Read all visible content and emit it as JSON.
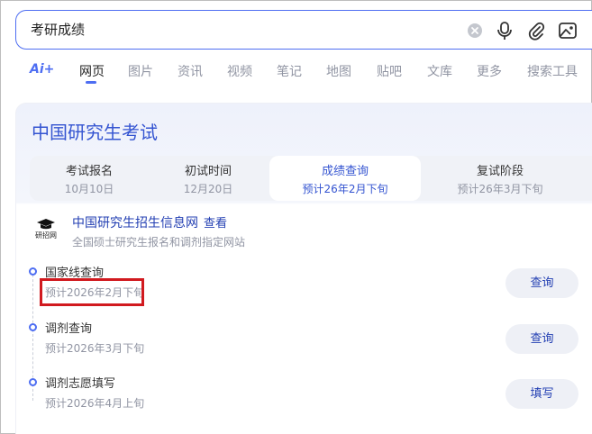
{
  "search": {
    "query": "考研成绩"
  },
  "tabs": {
    "ai": "Ai+",
    "items": [
      "网页",
      "图片",
      "资讯",
      "视频",
      "笔记",
      "地图",
      "贴吧",
      "文库",
      "更多",
      "搜索工具"
    ],
    "active_index": 0
  },
  "card": {
    "title": "中国研究生考试",
    "stages": [
      {
        "label": "考试报名",
        "date": "10月10日"
      },
      {
        "label": "初试时间",
        "date": "12月20日"
      },
      {
        "label": "成绩查询",
        "date": "预计26年2月下旬"
      },
      {
        "label": "复试阶段",
        "date": "预计26年3月下旬"
      }
    ],
    "active_stage": 2,
    "source": {
      "name": "中国研究生招生信息网",
      "view": "查看",
      "desc": "全国硕士研究生报名和调剂指定网站",
      "logo_text": "研招网"
    },
    "timeline": [
      {
        "title": "国家线查询",
        "date": "预计2026年2月下旬",
        "button": "查询"
      },
      {
        "title": "调剂查询",
        "date": "预计2026年3月下旬",
        "button": "查询"
      },
      {
        "title": "调剂志愿填写",
        "date": "预计2026年4月上旬",
        "button": "填写"
      }
    ]
  },
  "colors": {
    "accent": "#4e6ef2",
    "link": "#2440b3",
    "highlight": "#d11a1f"
  }
}
